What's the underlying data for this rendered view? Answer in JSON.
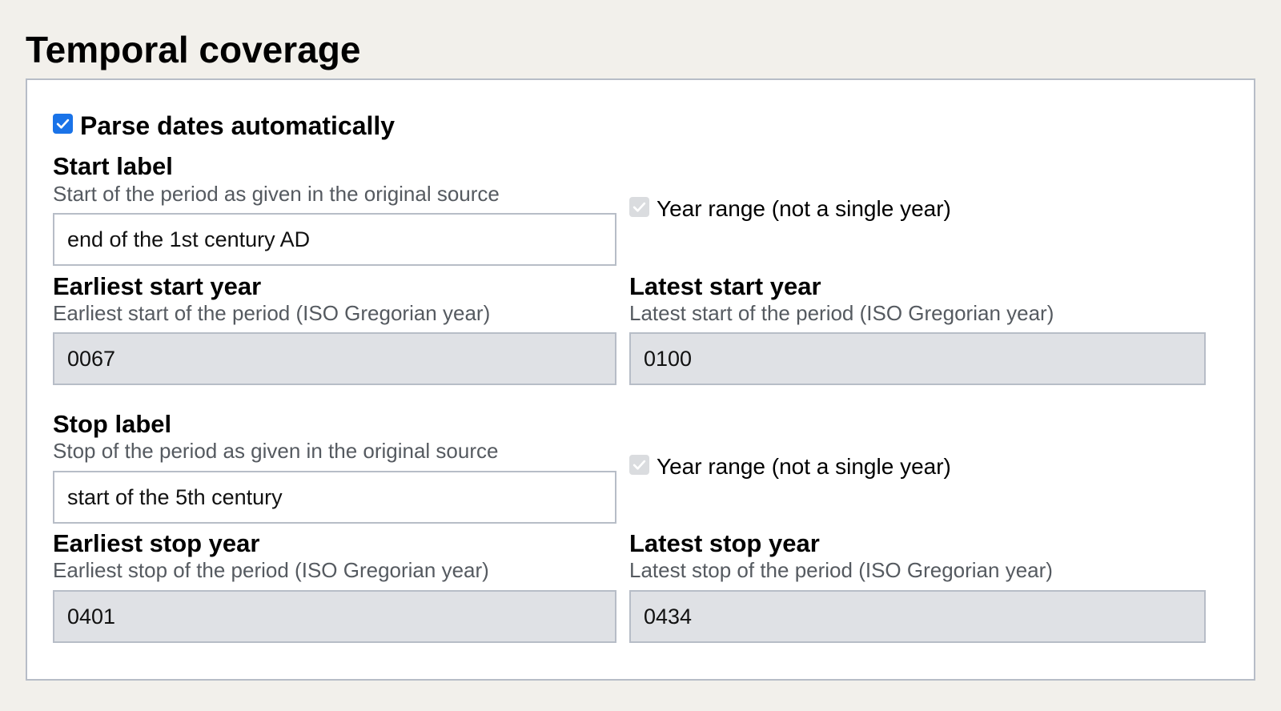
{
  "section": {
    "title": "Temporal coverage"
  },
  "parse_dates": {
    "label": "Parse dates automatically",
    "checked": true
  },
  "start": {
    "label": "Start label",
    "help": "Start of the period as given in the original source",
    "value": "end of the 1st century AD",
    "year_range_label": "Year range (not a single year)",
    "year_range_checked": true,
    "earliest": {
      "label": "Earliest start year",
      "help": "Earliest start of the period (ISO Gregorian year)",
      "value": "0067"
    },
    "latest": {
      "label": "Latest start year",
      "help": "Latest start of the period (ISO Gregorian year)",
      "value": "0100"
    }
  },
  "stop": {
    "label": "Stop label",
    "help": "Stop of the period as given in the original source",
    "value": "start of the 5th century",
    "year_range_label": "Year range (not a single year)",
    "year_range_checked": true,
    "earliest": {
      "label": "Earliest stop year",
      "help": "Earliest stop of the period (ISO Gregorian year)",
      "value": "0401"
    },
    "latest": {
      "label": "Latest stop year",
      "help": "Latest stop of the period (ISO Gregorian year)",
      "value": "0434"
    }
  }
}
